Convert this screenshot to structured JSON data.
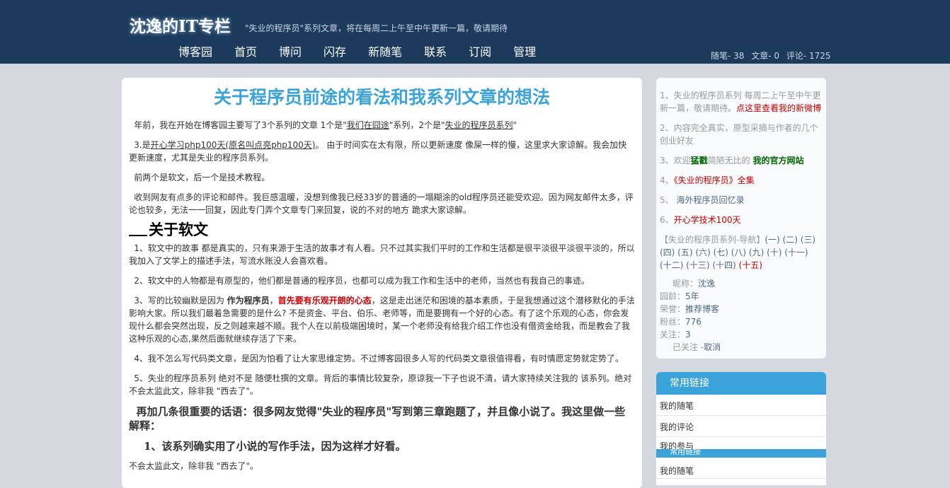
{
  "header": {
    "title": "沈逸的IT专栏",
    "subtitle": "\"失业的程序员\"系列文章，将在每周二上午至中午更新一篇，敬请期待",
    "nav": [
      "博客园",
      "首页",
      "博问",
      "闪存",
      "新随笔",
      "联系",
      "订阅",
      "管理"
    ],
    "stats": [
      "随笔- 38",
      "文章- 0",
      "评论- 1725"
    ]
  },
  "post": {
    "title": "关于程序员前途的看法和我系列文章的想法",
    "p1_a": "年前，我在开始在博客园主要写了3个系列的文章 1个是\"",
    "p1_link1": "我们在囧途",
    "p1_b": "\"系列，2个是\"",
    "p1_link2": "失业的程序员系列",
    "p1_c": "\"",
    "p2_a": "3.是",
    "p2_link": "开心学习php100天(原名叫点亮php100天)",
    "p2_b": "。 由于时间实在太有限，所以更新速度 像屎一样的慢，这里求大家谅解。我会加快更新速度，尤其是失业的程序员系列。",
    "p3": "前两个是软文，后一个是技术教程。",
    "p4": "收到网友有点多的评论和邮件。我巨感温暖，没想到像我已经33岁的普通的一塌糊涂的old程序员还能受欢迎。因为网友邮件太多，评论也较多，无法一一回复，因此专门弄个文章专门来回复，说的不对的地方 跪求大家谅解。",
    "h_soft": "关于软文",
    "s1": "1、软文中的故事 都是真实的，只有来源于生活的故事才有人看。只不过其实我们平时的工作和生活都是很平淡很平淡很平淡的，所以我加入了文学上的描述手法，写流水账没人会喜欢看。",
    "s2": "2、软文中的人物都是有原型的，他们都是普通的程序员，也都可以成为我工作和生活中的老师，当然也有我自己的事迹。",
    "s3_a": "3、写的比较幽默是因为 ",
    "s3_b": "作为程序员",
    "s3_c": "，",
    "s3_d": "首先要有乐观开朗的心态",
    "s3_e": "，这是走出迷茫和困境的基本素质，于是我想通过这个潜移默化的手法影响大家。所以我们最着急需要的是什么? 不是资金、平台、伯乐、老师等，而是要拥有一个好的心态。有了这个乐观的心态，你会发现什么都会突然出现，反之则越来越不顺。我个人在以前极端困境时，某一个老师没有给我介绍工作也没有借资金给我，而是教会了我这种乐观的心态,果然后面就继续存活了下来。",
    "s4": "4、我不怎么写代码类文章，是因为怕看了让大家思维定势。不过博客园很多人写的代码类文章很值得看，有时情愿定势就定势了。",
    "s5": "5、失业的程序员系列 绝对不是 随便杜撰的文章。背后的事情比较复杂，原谅我一下子也说不清，请大家持续关注我的 该系列。绝对不会太监此文，除非我 \"西去了\"。",
    "b1": "再加几条很重要的话语：很多网友觉得\"失业的程序员\"写到第三章跑题了，并且像小说了。我这里做一些解释：",
    "b2": "1、该系列确实用了小说的写作手法，因为这样才好看。",
    "tail": "不会太监此文，除非我 \"西去了\"。"
  },
  "sidebar": {
    "n1_a": "1、失业的程序员系列 每周二上午至中午更新一篇，敬请期待。",
    "n1_link": "点这里查看我的新微博",
    "n2": "2、内容完全真实，原型采摘与作者的几个创业好友",
    "n3_a": "3、欢迎",
    "n3_b": "猛戳",
    "n3_c": "简陋无比的 ",
    "n3_link": "我的官方网站",
    "n4_a": "4、",
    "n4_link": "《失业的程序员》全集",
    "n5_a": "5、 ",
    "n5_link": "海外程序员回忆录",
    "n6_a": "6、",
    "n6_link": "开心学技术100天",
    "nav_a": "【失业的程序员系列-导航】",
    "nav_items": "(一) (二) (三) (四) (五) (六) (七) (八) (九) (十) (十一) (十二) (十三) (十四)",
    "nav_last": " (十五)",
    "profile": {
      "nick_label": "昵称：",
      "nick": "沈逸",
      "age_label": "园龄：",
      "age": "5年",
      "honor_label": "荣誉：",
      "honor": "推荐博客",
      "fans_label": "粉丝：",
      "fans": "776",
      "follow_label": "关注：",
      "follow": "3",
      "followed": "已关注 -",
      "cancel": "取消"
    },
    "links_title": "常用链接",
    "links": [
      "我的随笔",
      "我的评论",
      "我的参与"
    ],
    "links_ghost": "常用链接",
    "links_tail": "我的随笔"
  },
  "colors": {
    "header_bg": "#1b3a5c",
    "title_blue": "#3aa3d9",
    "link_red": "#cc0000"
  }
}
